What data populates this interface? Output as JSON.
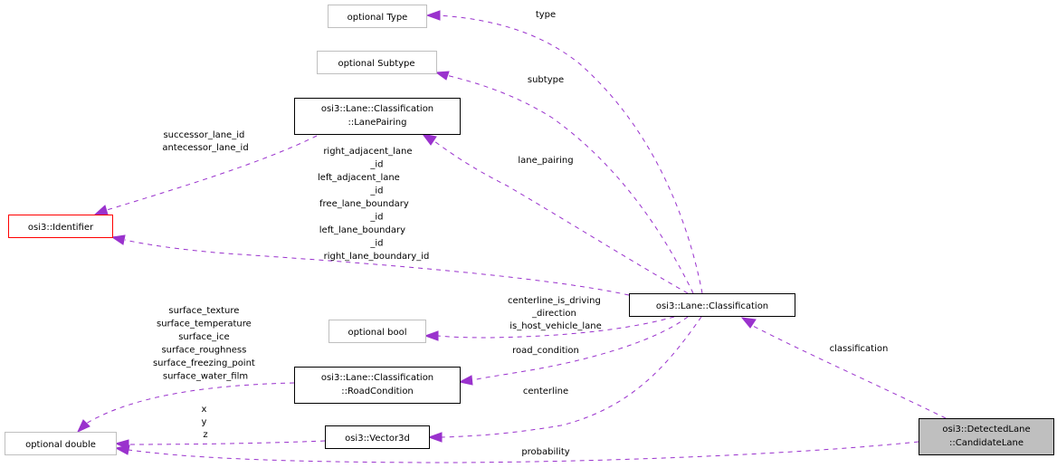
{
  "diagram": {
    "type": "collaboration-graph",
    "colors": {
      "edge": "#9a32cd",
      "node_border": "#000000",
      "node_border_external": "#bfbfbf",
      "node_border_incomplete": "#ff0000",
      "focus_fill": "#bfbfbf"
    },
    "nodes": {
      "optional_type": {
        "lines": [
          "optional Type"
        ]
      },
      "optional_subtype": {
        "lines": [
          "optional Subtype"
        ]
      },
      "lane_pairing": {
        "lines": [
          "osi3::Lane::Classification",
          "::LanePairing"
        ]
      },
      "identifier": {
        "lines": [
          "osi3::Identifier"
        ]
      },
      "optional_bool": {
        "lines": [
          "optional bool"
        ]
      },
      "road_condition": {
        "lines": [
          "osi3::Lane::Classification",
          "::RoadCondition"
        ]
      },
      "vector3d": {
        "lines": [
          "osi3::Vector3d"
        ]
      },
      "optional_double": {
        "lines": [
          "optional double"
        ]
      },
      "classification": {
        "lines": [
          "osi3::Lane::Classification"
        ]
      },
      "candidate_lane": {
        "lines": [
          "osi3::DetectedLane",
          "::CandidateLane"
        ]
      }
    },
    "edges": [
      {
        "from": "classification",
        "to": "optional_type",
        "label": [
          "type"
        ]
      },
      {
        "from": "classification",
        "to": "optional_subtype",
        "label": [
          "subtype"
        ]
      },
      {
        "from": "classification",
        "to": "lane_pairing",
        "label": [
          "lane_pairing"
        ]
      },
      {
        "from": "lane_pairing",
        "to": "identifier",
        "label": [
          "successor_lane_id",
          "antecessor_lane_id"
        ]
      },
      {
        "from": "classification",
        "to": "identifier",
        "label": [
          "right_adjacent_lane",
          "_id",
          "left_adjacent_lane",
          "_id",
          "free_lane_boundary",
          "_id",
          "left_lane_boundary",
          "_id",
          "right_lane_boundary_id"
        ]
      },
      {
        "from": "classification",
        "to": "optional_bool",
        "label": [
          "centerline_is_driving",
          "_direction",
          "is_host_vehicle_lane"
        ]
      },
      {
        "from": "classification",
        "to": "road_condition",
        "label": [
          "road_condition"
        ]
      },
      {
        "from": "classification",
        "to": "vector3d",
        "label": [
          "centerline"
        ]
      },
      {
        "from": "road_condition",
        "to": "optional_double",
        "label": [
          "surface_texture",
          "surface_temperature",
          "surface_ice",
          "surface_roughness",
          "surface_freezing_point",
          "surface_water_film"
        ]
      },
      {
        "from": "vector3d",
        "to": "optional_double",
        "label": [
          "x",
          "y",
          "z"
        ]
      },
      {
        "from": "candidate_lane",
        "to": "classification",
        "label": [
          "classification"
        ]
      },
      {
        "from": "candidate_lane",
        "to": "optional_double",
        "label": [
          "probability"
        ]
      }
    ]
  }
}
